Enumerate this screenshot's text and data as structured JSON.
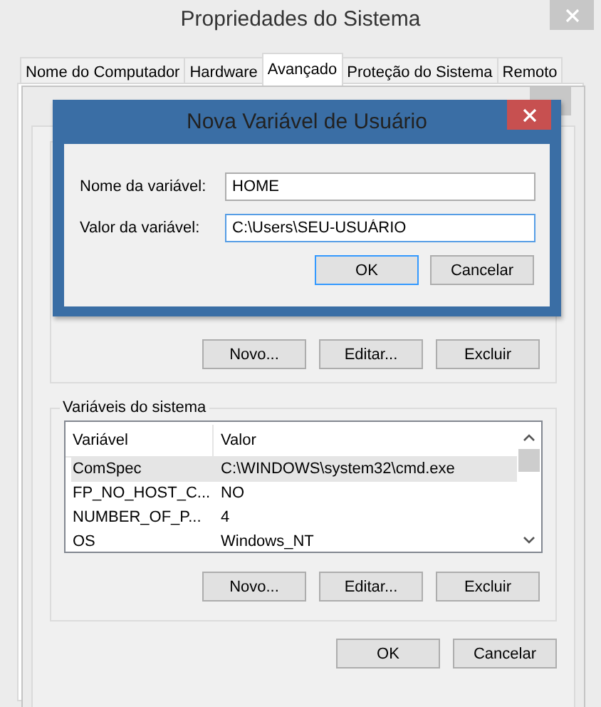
{
  "window": {
    "title": "Propriedades do Sistema"
  },
  "tabs": [
    {
      "label": "Nome do Computador",
      "selected": false
    },
    {
      "label": "Hardware",
      "selected": false
    },
    {
      "label": "Avançado",
      "selected": true
    },
    {
      "label": "Proteção do Sistema",
      "selected": false
    },
    {
      "label": "Remoto",
      "selected": false
    }
  ],
  "environment_window": {
    "user_buttons": [
      "Novo...",
      "Editar...",
      "Excluir"
    ],
    "system_variables": {
      "title": "Variáveis do sistema",
      "columns": [
        "Variável",
        "Valor"
      ],
      "rows": [
        {
          "variable": "ComSpec",
          "value": "C:\\WINDOWS\\system32\\cmd.exe",
          "selected": true
        },
        {
          "variable": "FP_NO_HOST_C...",
          "value": "NO",
          "selected": false
        },
        {
          "variable": "NUMBER_OF_P...",
          "value": "4",
          "selected": false
        },
        {
          "variable": "OS",
          "value": "Windows_NT",
          "selected": false
        }
      ]
    },
    "system_buttons": [
      "Novo...",
      "Editar...",
      "Excluir"
    ],
    "buttons": [
      "OK",
      "Cancelar"
    ]
  },
  "dialog": {
    "title": "Nova Variável de Usuário",
    "fields": [
      {
        "label": "Nome da variável:",
        "value": "HOME",
        "focused": false
      },
      {
        "label": "Valor da variável:",
        "value": "C:\\Users\\SEU-USUÁRIO",
        "focused": true
      }
    ],
    "buttons": [
      {
        "label": "OK",
        "default": true
      },
      {
        "label": "Cancelar",
        "default": false
      }
    ]
  }
}
